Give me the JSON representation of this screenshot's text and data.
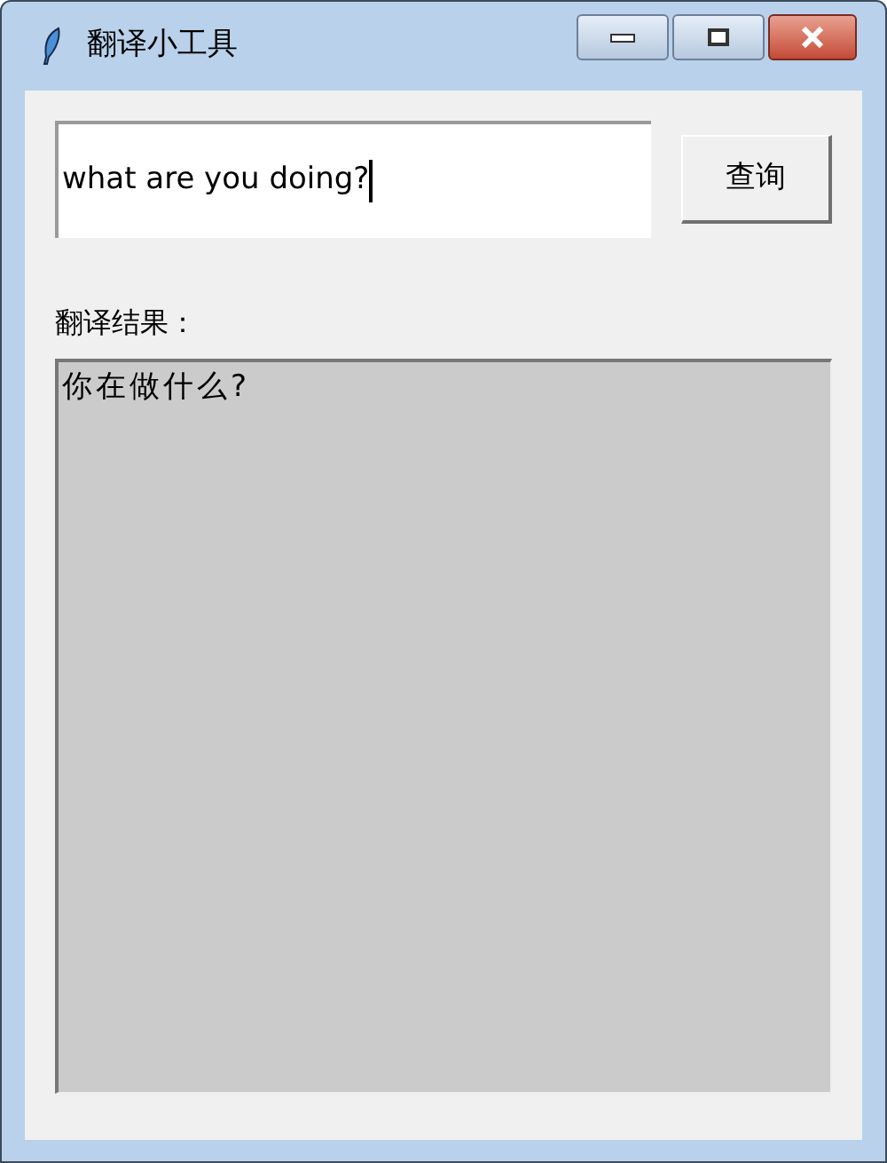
{
  "window": {
    "title": "翻译小工具"
  },
  "query": {
    "value": "what are you doing?",
    "focused": true
  },
  "search_button": {
    "label": "查询"
  },
  "result_label": "翻译结果：",
  "result": {
    "text": "你在做什么?"
  }
}
